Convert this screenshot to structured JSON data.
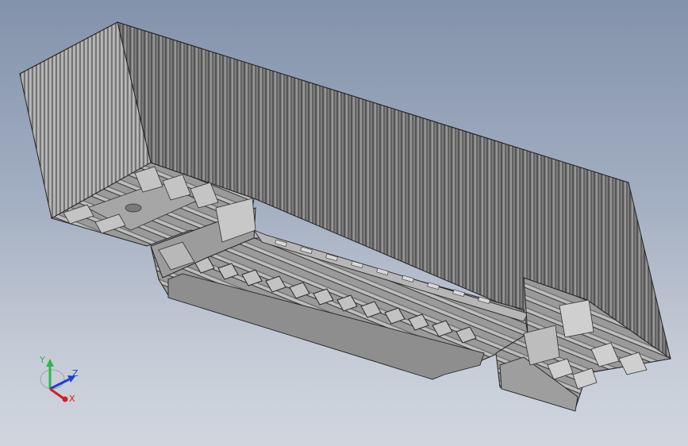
{
  "viewport": {
    "background_top": "#8392ab",
    "background_bottom": "#d0d5de",
    "model_name": ""
  },
  "model": {
    "description_icon": "trailer-box-3d-model",
    "face_color": "#8c8c8c",
    "edge_color": "#2a2a2a"
  },
  "triad": {
    "y_label": "Y",
    "z_label": "Z",
    "x_label": "X",
    "colors": {
      "y": "#2db84a",
      "z": "#1f3fd0",
      "x": "#d02020"
    }
  }
}
